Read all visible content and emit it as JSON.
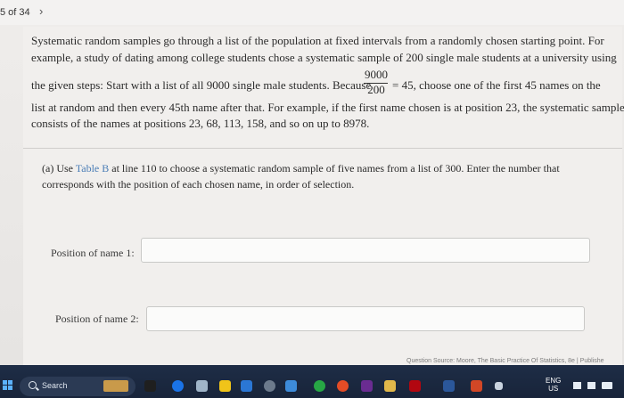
{
  "header": {
    "page_indicator": "5 of 34",
    "next_icon": "chevron-right-icon"
  },
  "intro": {
    "line1": "Systematic random samples go through a list of the population at fixed intervals from a randomly chosen starting point. For",
    "line2": "example, a study of dating among college students chose a systematic sample of 200 single male students at a university using",
    "line3a": "the given steps: Start with a list of all 9000 single male students. Because",
    "frac_numerator": "9000",
    "frac_denominator": "200",
    "line3b": "= 45, choose one of the first 45 names on the",
    "line4": "list at random and then every 45th name after that. For example, if the first name chosen is at position 23, the systematic sample",
    "line5": "consists of the names at positions 23, 68, 113, 158, and so on up to 8978."
  },
  "question": {
    "part_a_prefix": "(a) Use ",
    "part_a_link": "Table B",
    "part_a_suffix": " at line 110 to choose a systematic random sample of five names from a list of 300. Enter the number that",
    "part_a_line2": "corresponds with the position of each chosen name, in order of selection."
  },
  "fields": [
    {
      "label": "Position of name 1:",
      "value": ""
    },
    {
      "label": "Position of name 2:",
      "value": ""
    }
  ],
  "source_text": "Question Source: Moore, The Basic Practice Of Statistics, 8e | Publishe",
  "taskbar": {
    "search_label": "Search",
    "lang_line1": "ENG",
    "lang_line2": "US",
    "icons": [
      "windows-icon",
      "search-icon",
      "widget-icon",
      "app-icon",
      "edge-icon",
      "file-explorer-icon",
      "store-icon",
      "mail-icon",
      "settings-icon",
      "chrome-icon",
      "app-icon",
      "opera-icon",
      "netflix-icon",
      "word-icon",
      "photos-icon",
      "music-icon"
    ],
    "colors": {
      "accent": "#4a7db6",
      "taskbar": "#1e2d46"
    }
  }
}
